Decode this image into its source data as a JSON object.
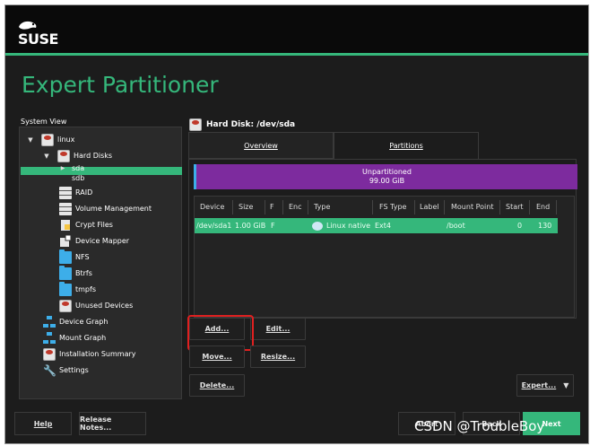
{
  "logo": {
    "text": "SUSE"
  },
  "title": "Expert Partitioner",
  "system_view": {
    "label": "System View"
  },
  "tree": [
    {
      "label": "linux",
      "icon": "disk-icon"
    },
    {
      "label": "Hard Disks",
      "icon": "disk-icon"
    },
    {
      "label": "sda",
      "icon": ""
    },
    {
      "label": "sdb",
      "icon": ""
    },
    {
      "label": "RAID",
      "icon": "stack-icon"
    },
    {
      "label": "Volume Management",
      "icon": "stack-icon"
    },
    {
      "label": "Crypt Files",
      "icon": "lock-icon"
    },
    {
      "label": "Device Mapper",
      "icon": "device-mapper-icon"
    },
    {
      "label": "NFS",
      "icon": "folder-icon"
    },
    {
      "label": "Btrfs",
      "icon": "folder-icon"
    },
    {
      "label": "tmpfs",
      "icon": "folder-icon"
    },
    {
      "label": "Unused Devices",
      "icon": "disk-icon"
    },
    {
      "label": "Device Graph",
      "icon": "graph-icon"
    },
    {
      "label": "Mount Graph",
      "icon": "graph-icon"
    },
    {
      "label": "Installation Summary",
      "icon": "disk-icon"
    },
    {
      "label": "Settings",
      "icon": "wrench-icon"
    }
  ],
  "right_header": "Hard Disk: /dev/sda",
  "tabs": {
    "overview": "Overview",
    "partitions": "Partitions"
  },
  "unpartitioned": {
    "line1": "Unpartitioned",
    "line2": "99.00 GiB"
  },
  "table": {
    "headers": [
      "Device",
      "Size",
      "F",
      "Enc",
      "Type",
      "FS Type",
      "Label",
      "Mount Point",
      "Start",
      "End"
    ],
    "rows": [
      [
        "/dev/sda1",
        "1.00 GiB",
        "F",
        "",
        "Linux native",
        "Ext4",
        "",
        "/boot",
        "0",
        "130"
      ]
    ]
  },
  "buttons": {
    "add": "Add...",
    "edit": "Edit...",
    "move": "Move...",
    "resize": "Resize...",
    "delete": "Delete...",
    "expert": "Expert..."
  },
  "footer": {
    "help": "Help",
    "release_notes": "Release Notes...",
    "abort": "Abort",
    "back": "Back",
    "next": "Next"
  },
  "watermark": "CSDN @TroubleBoy",
  "colors": {
    "accent": "#35b77b",
    "unpartitioned": "#7d2b9e",
    "highlight": "#e02020"
  }
}
